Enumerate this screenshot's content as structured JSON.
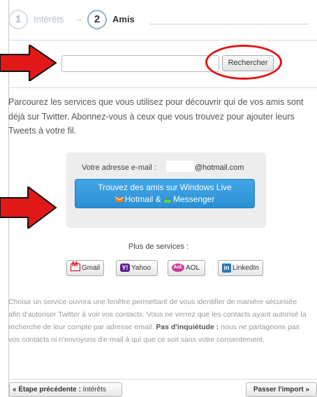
{
  "steps": {
    "step1_number": "1",
    "step1_label": "Intérêts",
    "arrow": "→",
    "step2_number": "2",
    "step2_label": "Amis"
  },
  "search": {
    "input_value": "",
    "button_label": "Rechercher"
  },
  "intro": {
    "text": "Parcourez les services que vous utilisez pour découvrir qui de vos amis sont déjà sur Twitter. Abonnez-vous à ceux que vous trouvez pour ajouter leurs Tweets à votre fil."
  },
  "email": {
    "label": "Votre adresse e-mail :",
    "domain": "@hotmail.com",
    "button_line1": "Trouvez des amis sur Windows Live",
    "button_line2_a": "Hotmail &",
    "button_line2_b": "Messenger"
  },
  "more_services": {
    "label": "Plus de services :",
    "gmail": "Gmail",
    "yahoo": "Yahoo",
    "yahoo_icon_text": "Y!",
    "aol": "AOL",
    "aol_icon_text": "Aol.",
    "linkedin": "LinkedIn",
    "linkedin_icon_text": "in"
  },
  "disclaimer": {
    "text": "Choisir un service ouvrira une fenêtre permettant de vous identifier de manière sécurisée afin d'autoriser Twitter à voir vos contacts. Vous ne verrez que les contacts ayant autorisé la recherche de leur compte par adresse email.",
    "bold": "Pas d'inquiétude :",
    "text2": "nous ne partageons pas vos contacts ni n'envoyons d'e-mail à qui que ce soit sans votre consentement."
  },
  "footer": {
    "prev_bold": "« Étape précédente :",
    "prev_target": "Intérêts",
    "next_label": "Passer l'import »"
  },
  "colors": {
    "annotation_red": "#e01818",
    "windows_live_blue": "#2a8fd4"
  }
}
